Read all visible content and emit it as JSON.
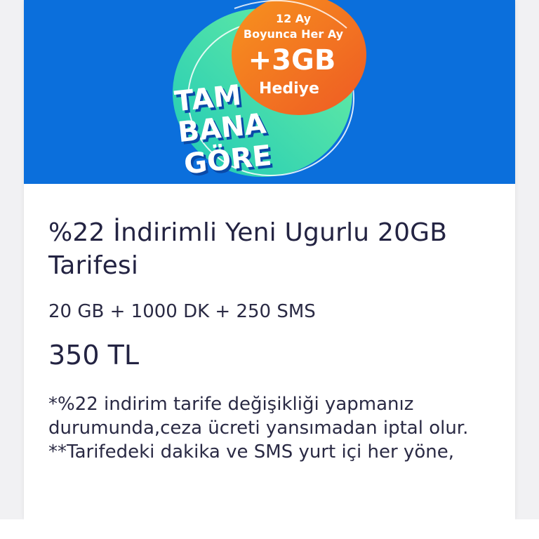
{
  "banner": {
    "promo_line1": "12 Ay",
    "promo_line2": "Boyunca Her Ay",
    "promo_amount": "+3GB",
    "promo_gift": "Hediye",
    "brand_line1": "TAM",
    "brand_line2": "BANA",
    "brand_line3": "GÖRE",
    "colors": {
      "background": "#0b6fdc",
      "orange": "#f06a1d",
      "teal": "#28d6a6"
    }
  },
  "tariff": {
    "title": "%22 İndirimli Yeni Ugurlu 20GB Tarifesi",
    "summary": "20 GB + 1000 DK + 250 SMS",
    "price": "350 TL",
    "note1": "*%22 indirim tarife değişikliği yapmanız durumunda,ceza ücreti yansımadan iptal olur.",
    "note2": "**Tarifedeki dakika ve SMS yurt içi her yöne,"
  }
}
